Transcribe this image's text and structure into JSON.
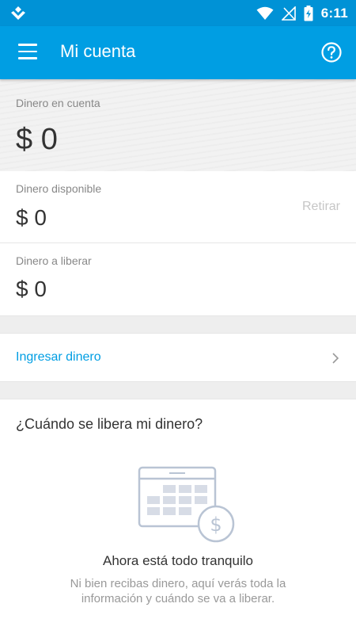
{
  "status_bar": {
    "time": "6:11",
    "icons": [
      "app-logo-icon",
      "wifi-icon",
      "no-signal-icon",
      "battery-charging-icon"
    ]
  },
  "app_bar": {
    "title": "Mi cuenta",
    "menu_icon": "menu-icon",
    "help_icon": "help-icon"
  },
  "balance": {
    "label": "Dinero en cuenta",
    "amount": "$ 0"
  },
  "available": {
    "label": "Dinero disponible",
    "amount": "$ 0",
    "withdraw_label": "Retirar"
  },
  "to_release": {
    "label": "Dinero a liberar",
    "amount": "$ 0"
  },
  "deposit": {
    "label": "Ingresar dinero"
  },
  "info": {
    "heading": "¿Cuándo se libera mi dinero?",
    "illustration": "calendar-money-icon",
    "calm_title": "Ahora está todo tranquilo",
    "description": "Ni bien recibas dinero, aquí verás toda la información y cuándo se va a liberar."
  },
  "colors": {
    "brand": "#009ee3",
    "status_bar": "#0092d6"
  }
}
